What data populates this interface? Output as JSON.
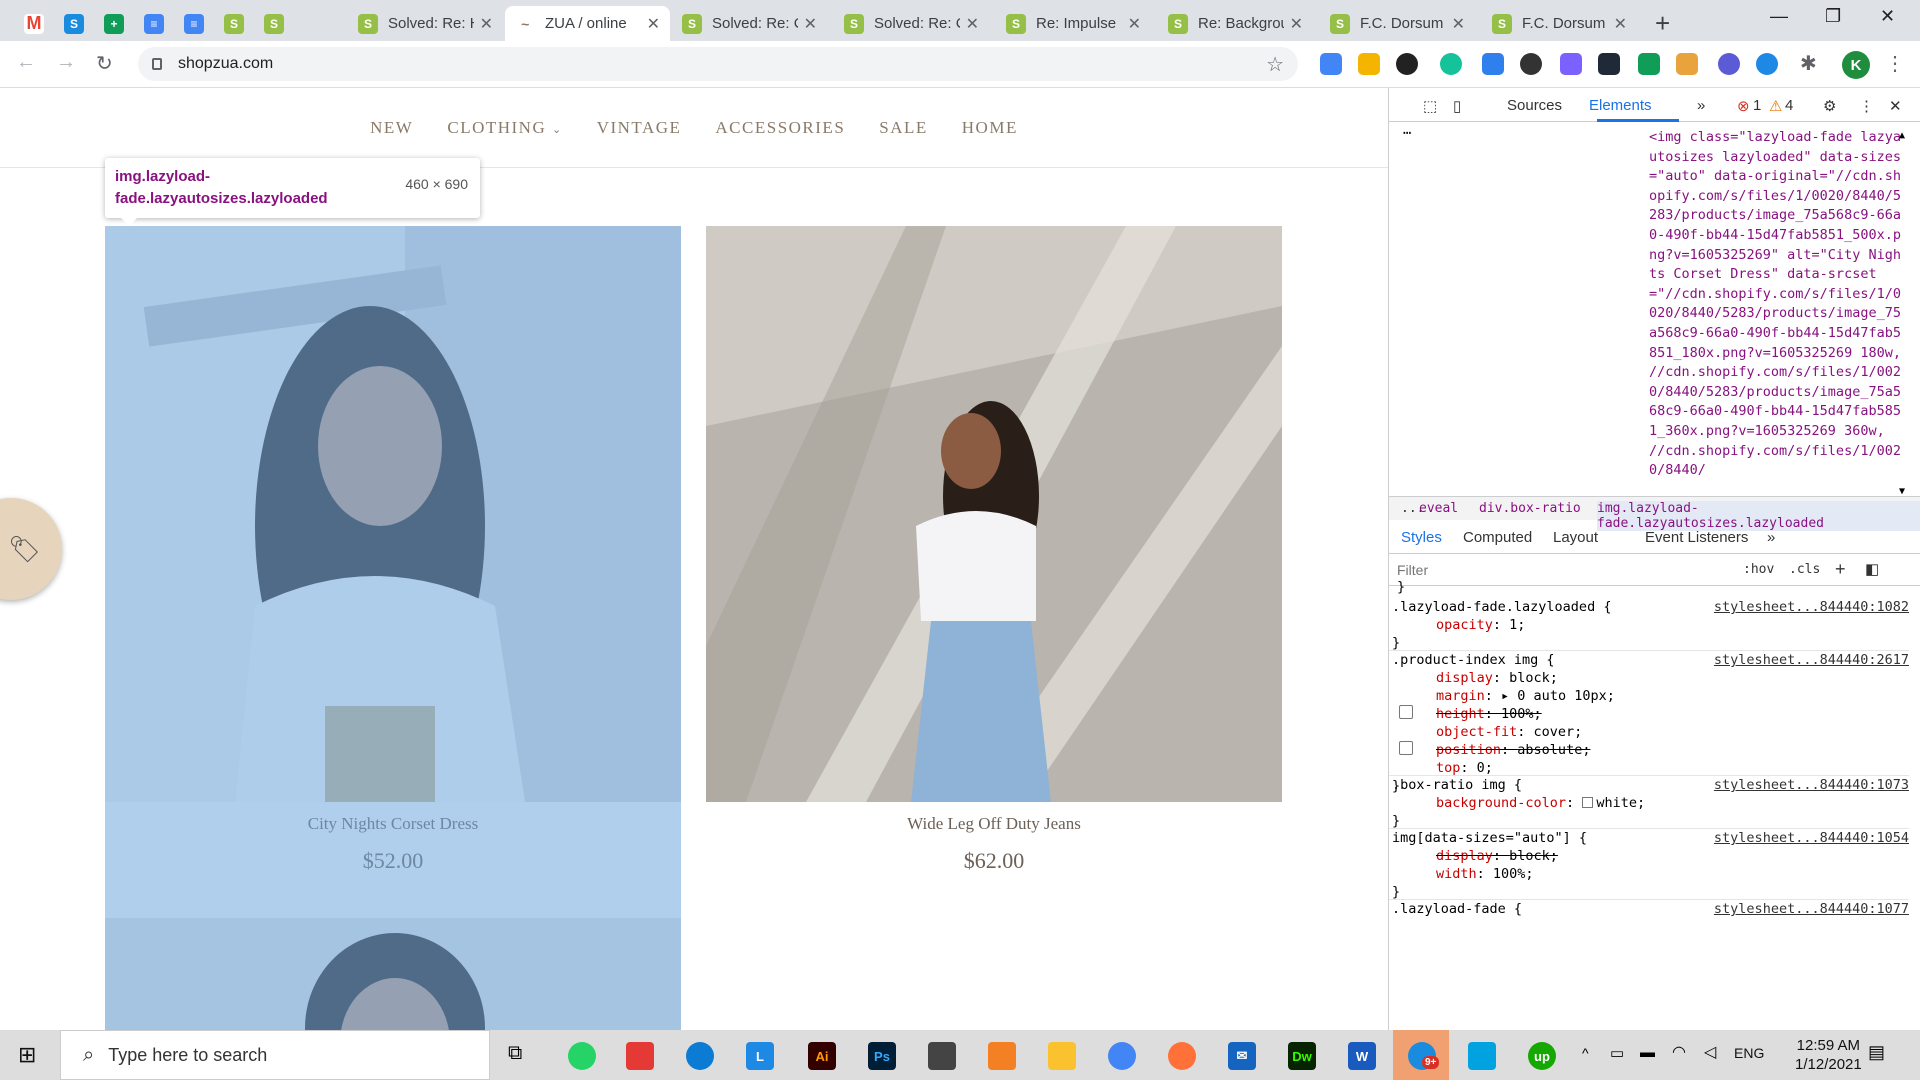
{
  "tabs": [
    {
      "title": "",
      "icon": "gmail-icon",
      "color": "#ea4335"
    },
    {
      "title": "",
      "icon": "skype-icon",
      "color": "#1a8ce0"
    },
    {
      "title": "",
      "icon": "sheets-icon",
      "color": "#0f9d58"
    },
    {
      "title": "",
      "icon": "docs-icon",
      "color": "#4285f4"
    },
    {
      "title": "",
      "icon": "docs-icon",
      "color": "#4285f4"
    },
    {
      "title": "",
      "icon": "shopify-icon",
      "color": "#95bf47"
    },
    {
      "title": "",
      "icon": "shopify-icon",
      "color": "#95bf47"
    },
    {
      "title": "Solved: Re: H",
      "icon": "shopify-icon",
      "color": "#95bf47"
    },
    {
      "title": "ZUA / online",
      "icon": "zua-icon",
      "color": "#8a7a6a",
      "active": true
    },
    {
      "title": "Solved: Re: C",
      "icon": "shopify-icon",
      "color": "#95bf47"
    },
    {
      "title": "Solved: Re: C",
      "icon": "shopify-icon",
      "color": "#95bf47"
    },
    {
      "title": "Re: Impulse",
      "icon": "shopify-icon",
      "color": "#95bf47"
    },
    {
      "title": "Re: Backgrou",
      "icon": "shopify-icon",
      "color": "#95bf47"
    },
    {
      "title": "F.C. Dorsum",
      "icon": "shopify-icon",
      "color": "#95bf47"
    },
    {
      "title": "F.C. Dorsum",
      "icon": "shopify-icon",
      "color": "#95bf47"
    }
  ],
  "address": {
    "url": "shopzua.com"
  },
  "profile": {
    "initial": "K"
  },
  "site": {
    "nav": [
      "NEW",
      "CLOTHING",
      "VINTAGE",
      "ACCESSORIES",
      "SALE",
      "HOME"
    ],
    "tooltip": {
      "selector": "img.lazyload-fade.lazyautosizes.lazyloaded",
      "dimensions": "460 × 690"
    },
    "products": [
      {
        "title": "City Nights Corset Dress",
        "price": "$52.00"
      },
      {
        "title": "Wide Leg Off Duty Jeans",
        "price": "$62.00"
      }
    ],
    "badge_icon": "discount-tag-icon"
  },
  "devtools": {
    "tabs": {
      "sources": "Sources",
      "elements": "Elements",
      "errors": "1",
      "warnings": "4"
    },
    "element_code": "<img class=\"lazyload-fade lazyautosizes lazyloaded\" data-sizes=\"auto\" data-original=\"//cdn.shopify.com/s/files/1/0020/8440/5283/products/image_75a568c9-66a0-490f-bb44-15d47fab5851_500x.png?v=1605325269\" alt=\"City Nights Corset Dress\" data-srcset=\"//cdn.shopify.com/s/files/1/0020/8440/5283/products/image_75a568c9-66a0-490f-bb44-15d47fab5851_180x.png?v=1605325269 180w, //cdn.shopify.com/s/files/1/0020/8440/5283/products/image_75a568c9-66a0-490f-bb44-15d47fab5851_360x.png?v=1605325269 360w, //cdn.shopify.com/s/files/1/0020/8440/",
    "crumbs": [
      "...",
      "eveal",
      "div.box-ratio",
      "img.lazyload-fade.lazyautosizes.lazyloaded"
    ],
    "style_tabs": [
      "Styles",
      "Computed",
      "Layout",
      "Event Listeners"
    ],
    "filter_placeholder": "Filter",
    "filter_tools": [
      ":hov",
      ".cls"
    ],
    "rules": [
      {
        "selector": ".lazyload-fade.lazyloaded {",
        "source": "stylesheet...844440:1082",
        "props": [
          {
            "name": "opacity",
            "value": "1;"
          }
        ]
      },
      {
        "selector": ".product-index img {",
        "source": "stylesheet...844440:2617",
        "props": [
          {
            "name": "display",
            "value": "block;"
          },
          {
            "name": "margin",
            "value": "▸ 0 auto 10px;"
          },
          {
            "name": "height",
            "value": "100%;",
            "struck": true
          },
          {
            "name": "object-fit",
            "value": "cover;"
          },
          {
            "name": "position",
            "value": "absolute;",
            "struck": true
          },
          {
            "name": "top",
            "value": "0;"
          }
        ]
      },
      {
        "selector": ".box-ratio img {",
        "source": "stylesheet...844440:1073",
        "props": [
          {
            "name": "background-color",
            "value": "white;"
          }
        ]
      },
      {
        "selector": "img[data-sizes=\"auto\"] {",
        "source": "stylesheet...844440:1054",
        "props": [
          {
            "name": "display",
            "value": "block;",
            "struck": true
          },
          {
            "name": "width",
            "value": "100%;"
          }
        ]
      },
      {
        "selector": ".lazyload-fade {",
        "source": "stylesheet...844440:1077",
        "props": []
      }
    ]
  },
  "taskbar": {
    "search_placeholder": "Type here to search",
    "lang": "ENG",
    "time": "12:59 AM",
    "date": "1/12/2021",
    "badge": "9+"
  }
}
